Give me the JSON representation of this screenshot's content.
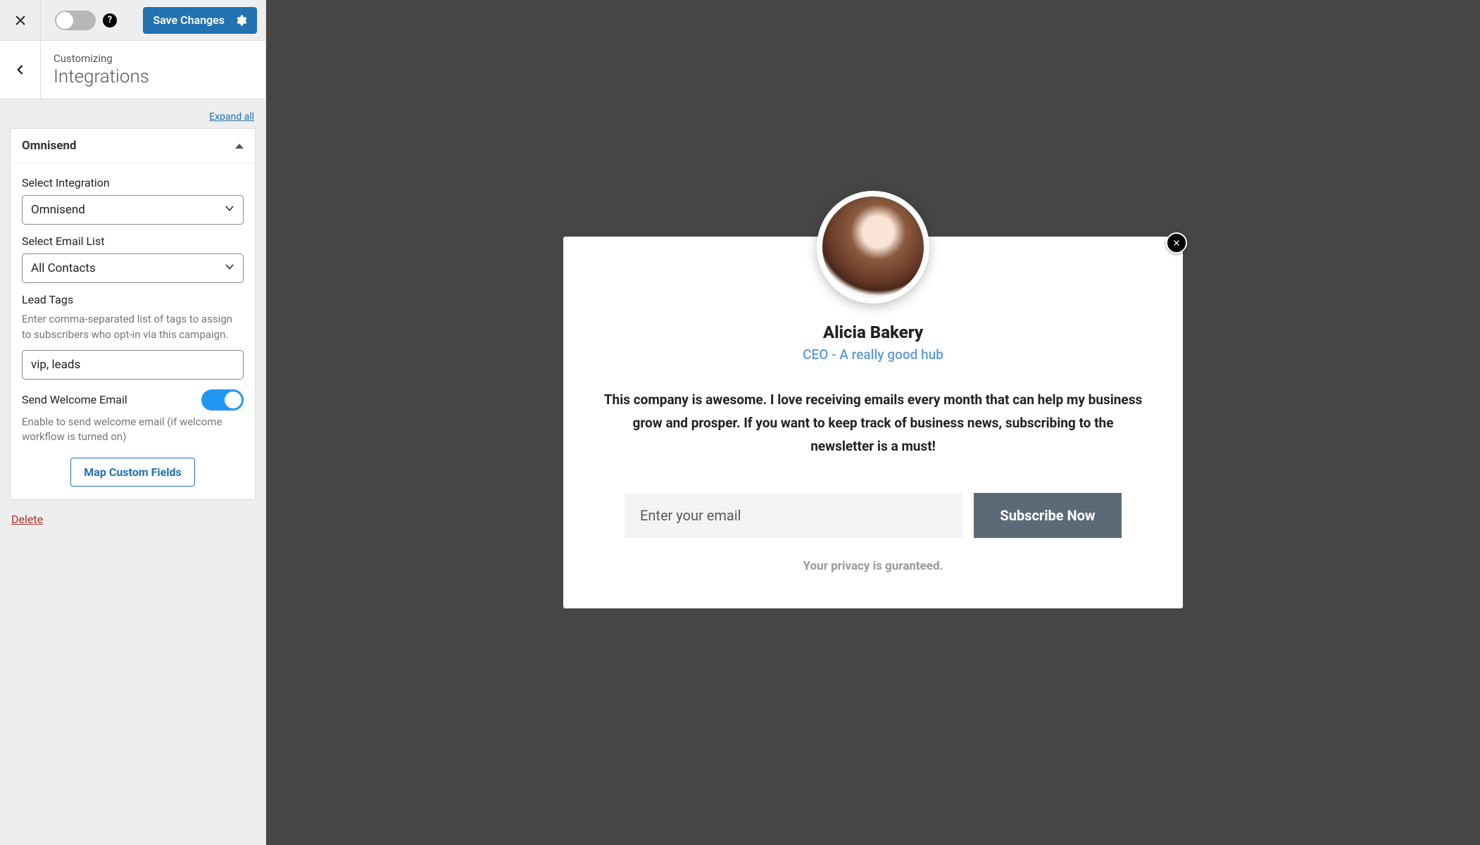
{
  "topbar": {
    "save_label": "Save Changes",
    "status_toggle_on": false
  },
  "breadcrumb": {
    "prefix": "Customizing",
    "title": "Integrations"
  },
  "expand_all_label": "Expand all",
  "panel": {
    "title": "Omnisend",
    "select_integration_label": "Select Integration",
    "select_integration_value": "Omnisend",
    "select_email_list_label": "Select Email List",
    "select_email_list_value": "All Contacts",
    "lead_tags_label": "Lead Tags",
    "lead_tags_help": "Enter comma-separated list of tags to assign to subscribers who opt-in via this campaign.",
    "lead_tags_value": "vip, leads",
    "send_welcome_label": "Send Welcome Email",
    "send_welcome_help": "Enable to send welcome email (if welcome workflow is turned on)",
    "send_welcome_on": true,
    "map_button_label": "Map Custom Fields"
  },
  "delete_label": "Delete",
  "popup": {
    "name": "Alicia Bakery",
    "title": "CEO - A really good hub",
    "body": "This company is awesome. I love receiving emails every month that can help my business grow and prosper. If you want to keep track of business news, subscribing to the newsletter is a must!",
    "email_placeholder": "Enter your email",
    "subscribe_label": "Subscribe Now",
    "privacy_text": "Your privacy is guranteed."
  },
  "colors": {
    "primary": "#2271b1",
    "accent_blue": "#2196f3",
    "danger": "#b32d2e",
    "popup_btn": "#5c6a78",
    "popup_link": "#5b9bd5"
  }
}
